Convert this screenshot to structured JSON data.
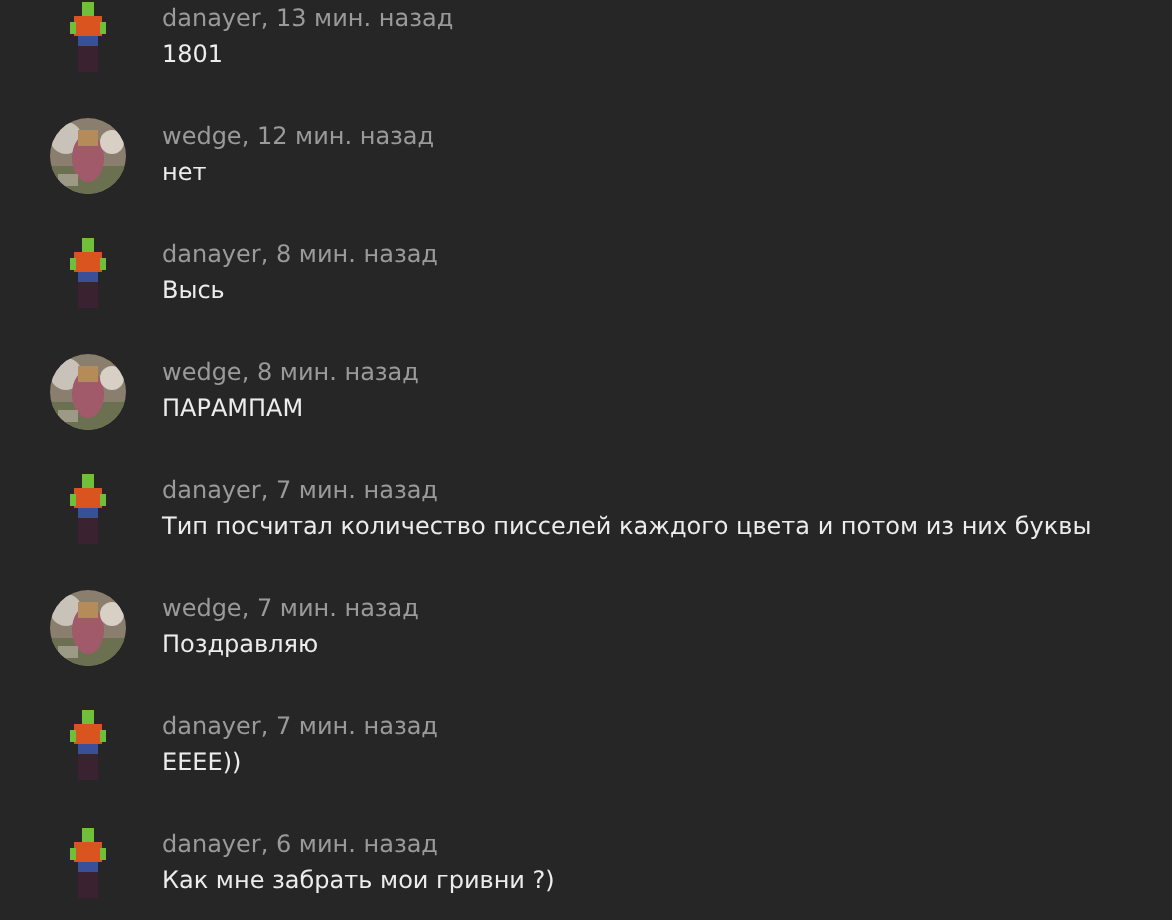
{
  "messages": [
    {
      "kind": "figure",
      "header": "danayer, 13 мин. назад",
      "text": "1801"
    },
    {
      "header": "wedge, 12 мин. назад",
      "text": "нет"
    },
    {
      "kind": "figure",
      "header": "danayer, 8 мин. назад",
      "text": "Высь"
    },
    {
      "header": "wedge, 8 мин. назад",
      "text": "ПАРАМПАМ"
    },
    {
      "kind": "figure",
      "header": "danayer, 7 мин. назад",
      "text": "Тип посчитал количество писселей каждого цвета и потом из них буквы"
    },
    {
      "header": "wedge, 7 мин. назад",
      "text": "Поздравляю"
    },
    {
      "kind": "figure",
      "header": "danayer, 7 мин. назад",
      "text": "ЕЕЕЕ))"
    },
    {
      "kind": "figure",
      "header": "danayer, 6 мин. назад",
      "text": "Как мне забрать мои гривни ?)"
    }
  ]
}
